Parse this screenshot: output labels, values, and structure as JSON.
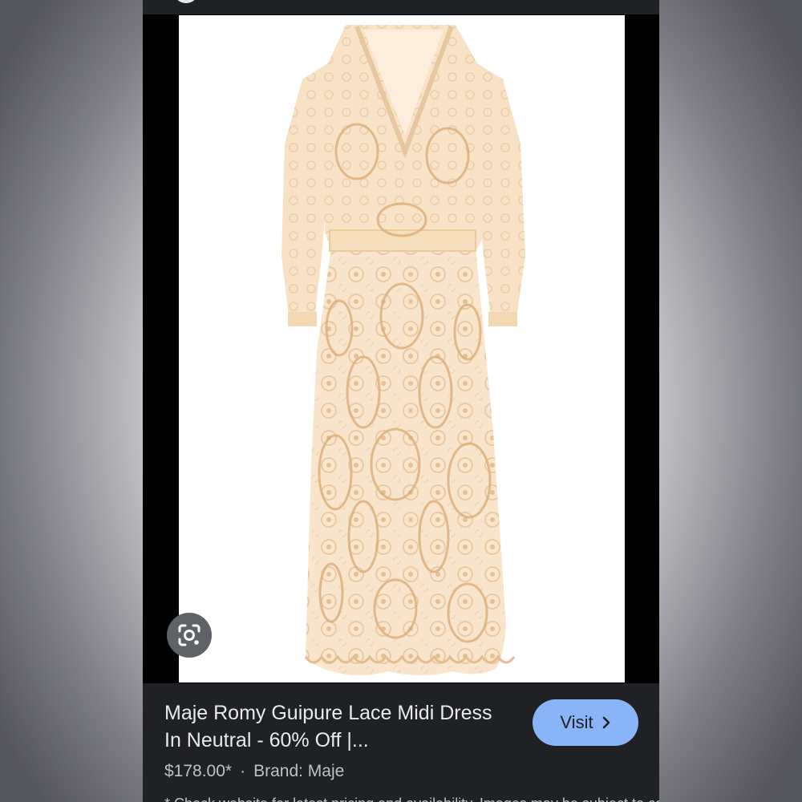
{
  "result": {
    "title": "Maje Romy Guipure Lace Midi Dress In Neutral - 60% Off |...",
    "price": "$178.00*",
    "separator": "·",
    "brand": "Brand: Maje",
    "visit_label": "Visit",
    "footnote_peek": "* Check website for latest pricing and availability. Images may be subject to copyright."
  },
  "icons": {
    "lens": "google-lens-icon",
    "visit_chevron": "chevron-right-icon"
  },
  "colors": {
    "panel_bg": "#202124",
    "title_text": "#e8eaed",
    "meta_text": "#bdc1c6",
    "visit_button_bg": "#8ab4f8",
    "lens_button_bg": "#5f6368",
    "dress": "#f8e3c8"
  }
}
